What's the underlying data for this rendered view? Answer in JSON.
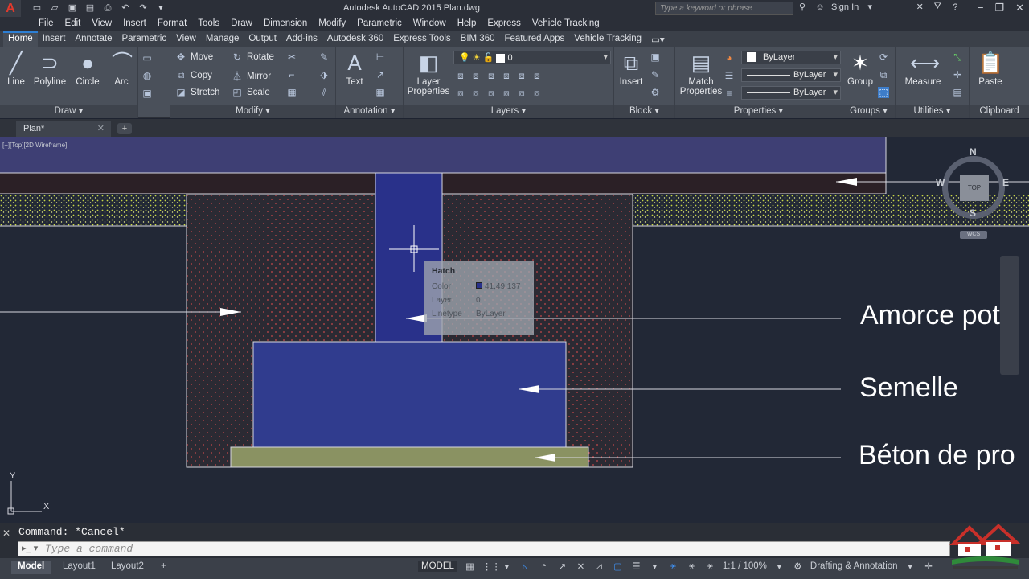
{
  "titlebar": {
    "app_title": "Autodesk AutoCAD 2015    Plan.dwg",
    "search_placeholder": "Type a keyword or phrase",
    "sign_in": "Sign In"
  },
  "menu": [
    "File",
    "Edit",
    "View",
    "Insert",
    "Format",
    "Tools",
    "Draw",
    "Dimension",
    "Modify",
    "Parametric",
    "Window",
    "Help",
    "Express",
    "Vehicle Tracking"
  ],
  "ribbon_tabs": [
    "Home",
    "Insert",
    "Annotate",
    "Parametric",
    "View",
    "Manage",
    "Output",
    "Add-ins",
    "Autodesk 360",
    "Express Tools",
    "BIM 360",
    "Featured Apps",
    "Vehicle Tracking"
  ],
  "ribbon": {
    "draw": {
      "title": "Draw",
      "line": "Line",
      "polyline": "Polyline",
      "circle": "Circle",
      "arc": "Arc"
    },
    "modify": {
      "title": "Modify",
      "move": "Move",
      "rotate": "Rotate",
      "copy": "Copy",
      "mirror": "Mirror",
      "stretch": "Stretch",
      "scale": "Scale"
    },
    "annotation": {
      "title": "Annotation",
      "text": "Text"
    },
    "layers": {
      "title": "Layers",
      "layer_properties_1": "Layer",
      "layer_properties_2": "Properties",
      "current_layer": "0"
    },
    "block": {
      "title": "Block",
      "insert": "Insert"
    },
    "properties": {
      "title": "Properties",
      "match_1": "Match",
      "match_2": "Properties",
      "color": "ByLayer",
      "linetype": "ByLayer",
      "lineweight": "ByLayer"
    },
    "groups": {
      "title": "Groups",
      "group": "Group"
    },
    "utilities": {
      "title": "Utilities",
      "measure": "Measure"
    },
    "clipboard": {
      "title": "Clipboard",
      "paste": "Paste"
    }
  },
  "doc_tab": {
    "name": "Plan*"
  },
  "viewport": {
    "label": "[−][Top][2D Wireframe]",
    "viewcube": {
      "n": "N",
      "s": "S",
      "e": "E",
      "w": "W",
      "face": "TOP",
      "wcs": "WCS"
    },
    "ucs": {
      "x": "X",
      "y": "Y"
    }
  },
  "tooltip": {
    "title": "Hatch",
    "color_label": "Color",
    "color_value": "41,49,137",
    "layer_label": "Layer",
    "layer_value": "0",
    "linetype_label": "Linetype",
    "linetype_value": "ByLayer"
  },
  "annotations": {
    "amorce": "Amorce pote",
    "semelle": "Semelle",
    "beton": "Béton de pro"
  },
  "command": {
    "history": "Command: *Cancel*",
    "placeholder": "Type a command"
  },
  "status": {
    "layouts": [
      "Model",
      "Layout1",
      "Layout2"
    ],
    "model_space": "MODEL",
    "scale": "1:1 / 100%",
    "workspace": "Drafting & Annotation"
  },
  "colors": {
    "hatch_blue": "#29318a",
    "concrete": "#8a9262",
    "soil": "#2b2a33",
    "accent": "#2d7fd4"
  }
}
